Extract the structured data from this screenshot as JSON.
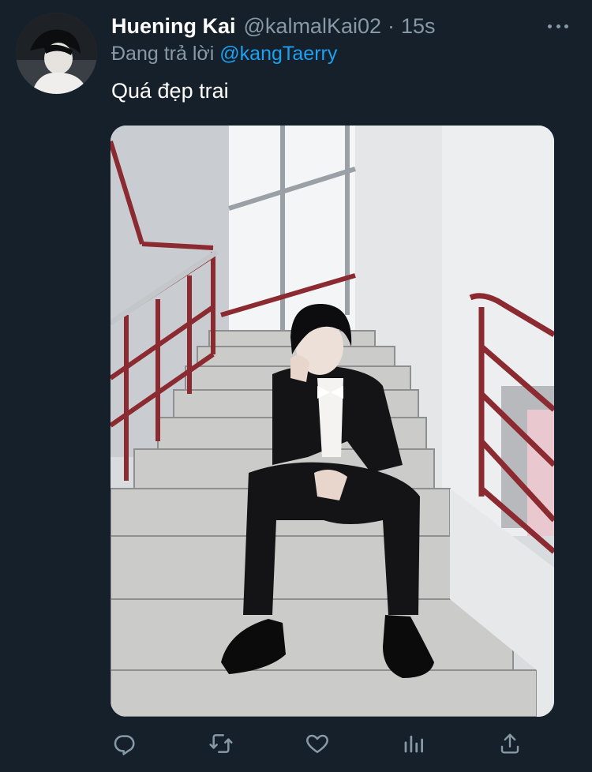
{
  "tweet": {
    "display_name": "Huening Kai",
    "handle": "@kalmalKai02",
    "separator": "·",
    "time": "15s",
    "reply_prefix": "Đang trả lời",
    "reply_to": "@kangTaerry",
    "text": "Quá đẹp trai"
  },
  "icons": {
    "more": "more-dots-icon",
    "reply": "reply-icon",
    "retweet": "retweet-icon",
    "like": "like-icon",
    "analytics": "analytics-icon",
    "share": "share-icon"
  },
  "colors": {
    "background": "#15202b",
    "secondary_text": "#8899a6",
    "link": "#1da1f2",
    "primary_text": "#ffffff"
  },
  "media": {
    "alt": "Photo of a young man in a black suit and white bow tie sitting on a staircase with red railings"
  }
}
